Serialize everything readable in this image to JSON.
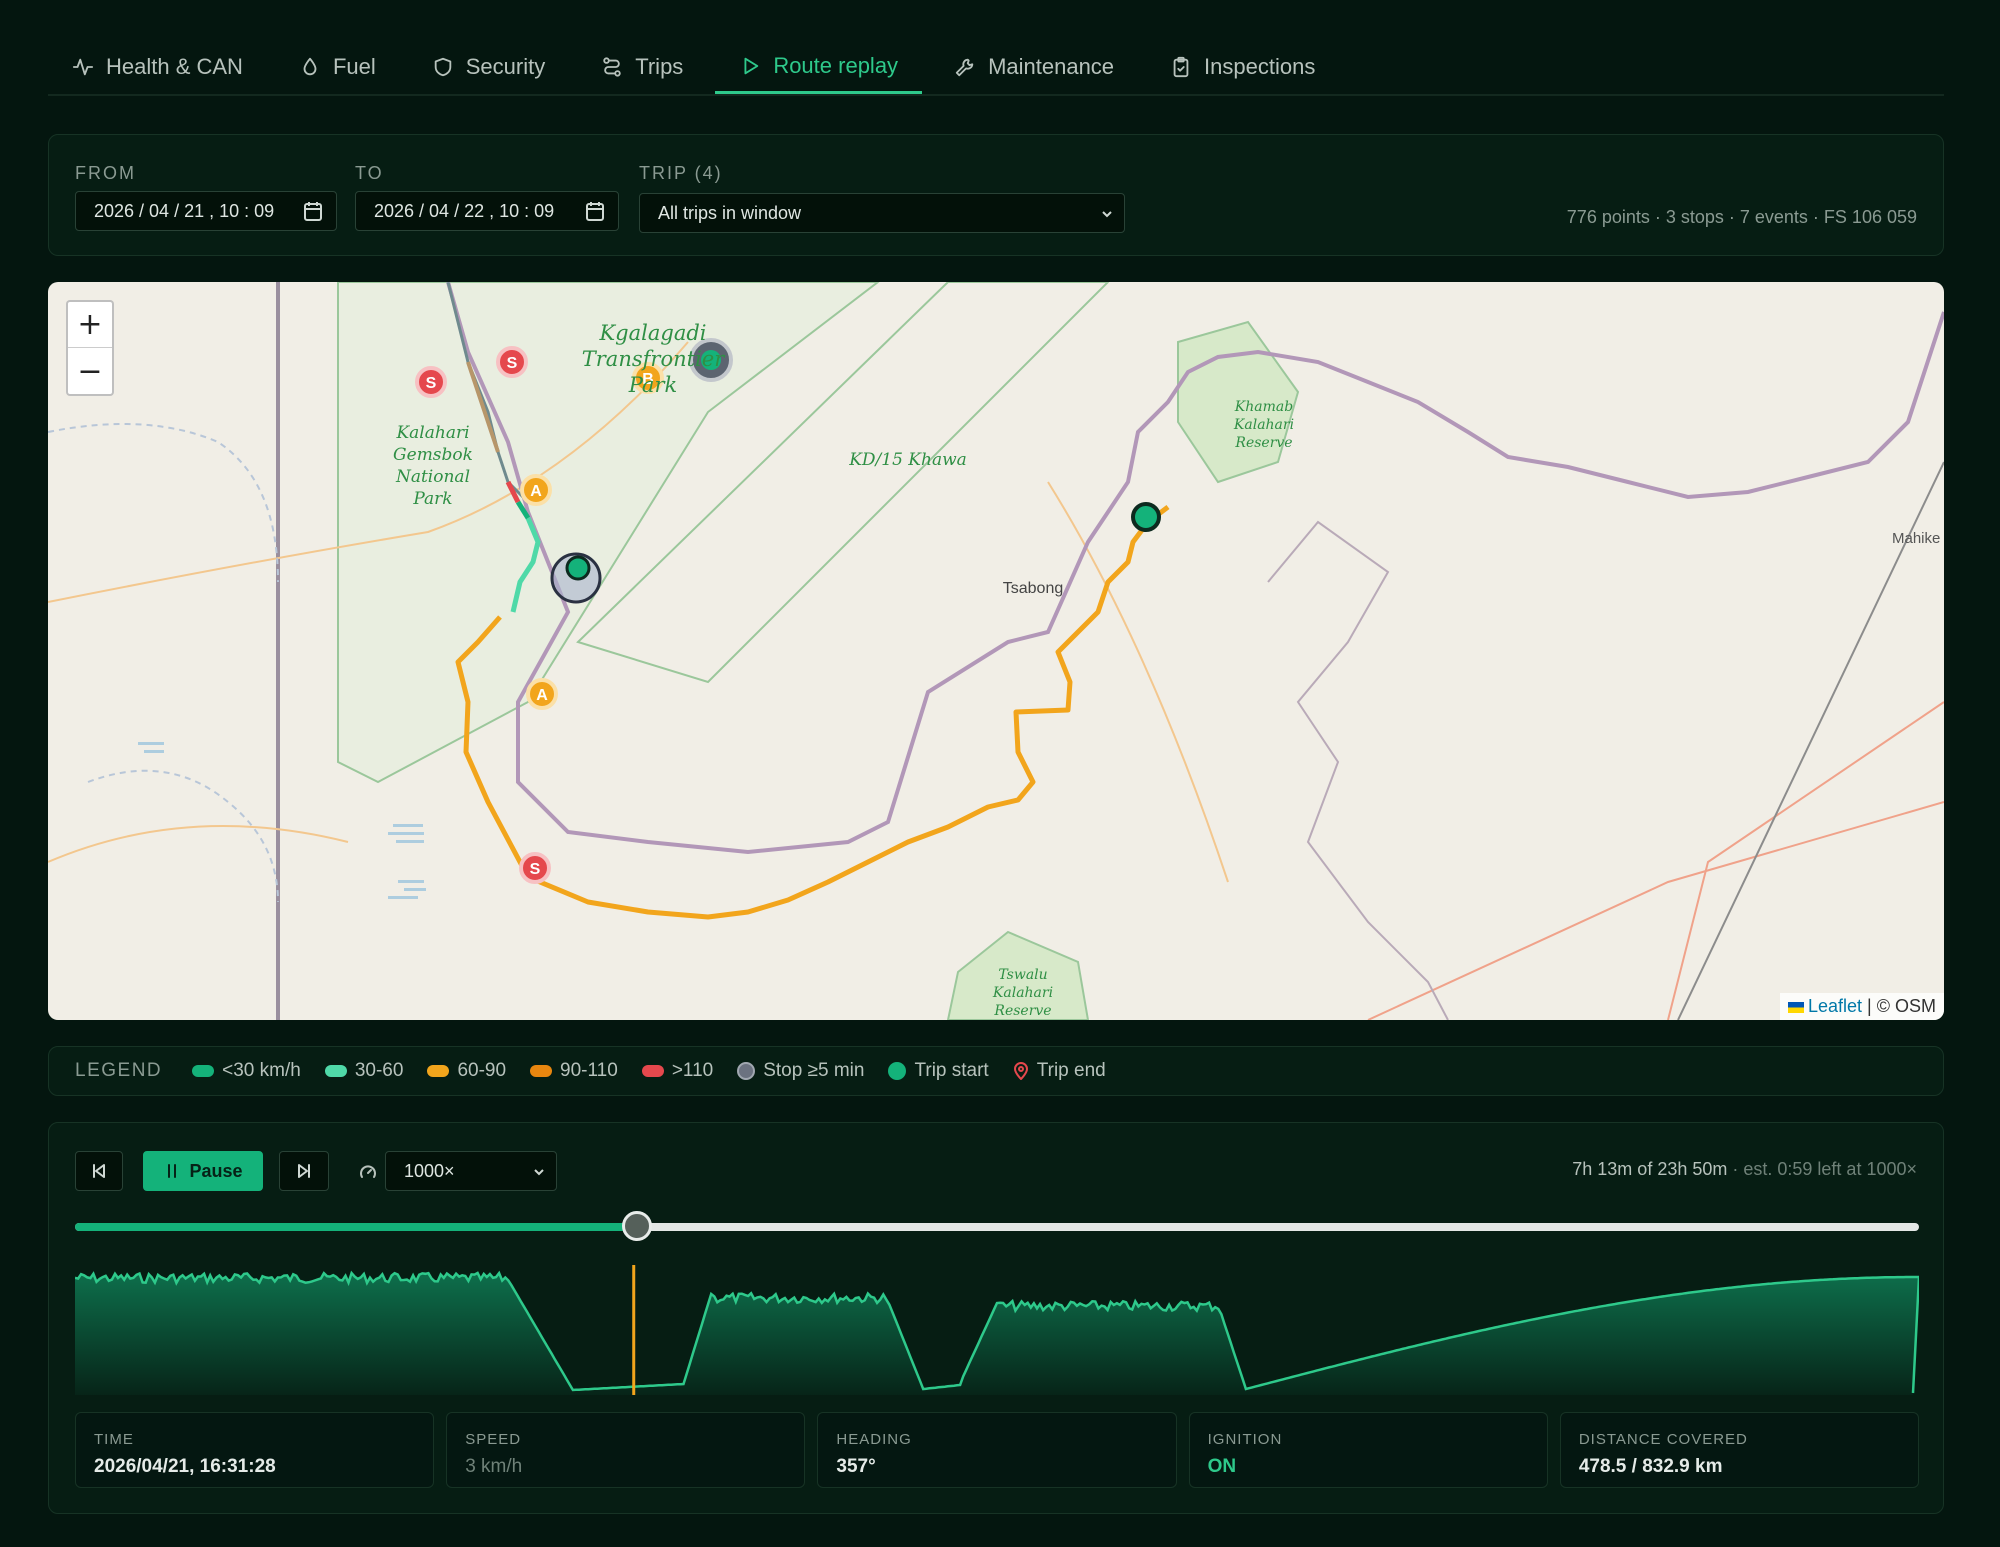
{
  "tabs": [
    {
      "label": "Health & CAN",
      "icon": "activity-icon"
    },
    {
      "label": "Fuel",
      "icon": "droplet-icon"
    },
    {
      "label": "Security",
      "icon": "shield-icon"
    },
    {
      "label": "Trips",
      "icon": "route-icon"
    },
    {
      "label": "Route replay",
      "icon": "play-icon"
    },
    {
      "label": "Maintenance",
      "icon": "wrench-icon"
    },
    {
      "label": "Inspections",
      "icon": "clipboard-check-icon"
    }
  ],
  "active_tab": "Route replay",
  "filters": {
    "from_label": "FROM",
    "from_value": "2026 / 04 / 21 ,  10 : 09",
    "to_label": "TO",
    "to_value": "2026 / 04 / 22 ,  10 : 09",
    "trip_label": "TRIP (4)",
    "trip_value": "All trips in window",
    "summary": "776 points · 3 stops · 7 events · FS 106 059"
  },
  "map": {
    "zoom_in": "+",
    "zoom_out": "−",
    "labels": {
      "kgalagadi": "Kgalagadi Transfrontier Park",
      "kalahari_gemsbok": "Kalahari Gemsbok National Park",
      "kd15": "KD/15 Khawa",
      "khamab": "Khamab Kalahari Reserve",
      "tsabong": "Tsabong",
      "tswalu": "Tswalu Kalahari Reserve",
      "mahikeng": "Mahike"
    },
    "markers": [
      "S",
      "S",
      "B",
      "A",
      "A",
      "S"
    ],
    "attribution": {
      "leaflet": "Leaflet",
      "separator": " | ",
      "osm": "© OSM"
    }
  },
  "legend": {
    "title": "LEGEND",
    "items": [
      {
        "label": "<30 km/h",
        "color": "#14b27a"
      },
      {
        "label": "30-60",
        "color": "#4fd9a8"
      },
      {
        "label": "60-90",
        "color": "#f2a51c"
      },
      {
        "label": "90-110",
        "color": "#e8860f"
      },
      {
        "label": ">110",
        "color": "#e5484d"
      },
      {
        "label": "Stop ≥5 min",
        "color": "#6b7280"
      },
      {
        "label": "Trip start",
        "color": "#14b27a"
      },
      {
        "label": "Trip end",
        "color": "#e5484d"
      }
    ]
  },
  "player": {
    "pause_label": "Pause",
    "speed_value": "1000×",
    "elapsed": "7h 13m of 23h 50m",
    "remaining": " · est. 0:59 left at 1000×",
    "progress": 0.305,
    "playhead": 0.303
  },
  "stats": {
    "time_label": "TIME",
    "time_value": "2026/04/21, 16:31:28",
    "speed_label": "SPEED",
    "speed_value": "3 km/h",
    "heading_label": "HEADING",
    "heading_value": "357°",
    "ignition_label": "IGNITION",
    "ignition_value": "ON",
    "distance_label": "DISTANCE COVERED",
    "distance_value": "478.5 / 832.9 km"
  }
}
